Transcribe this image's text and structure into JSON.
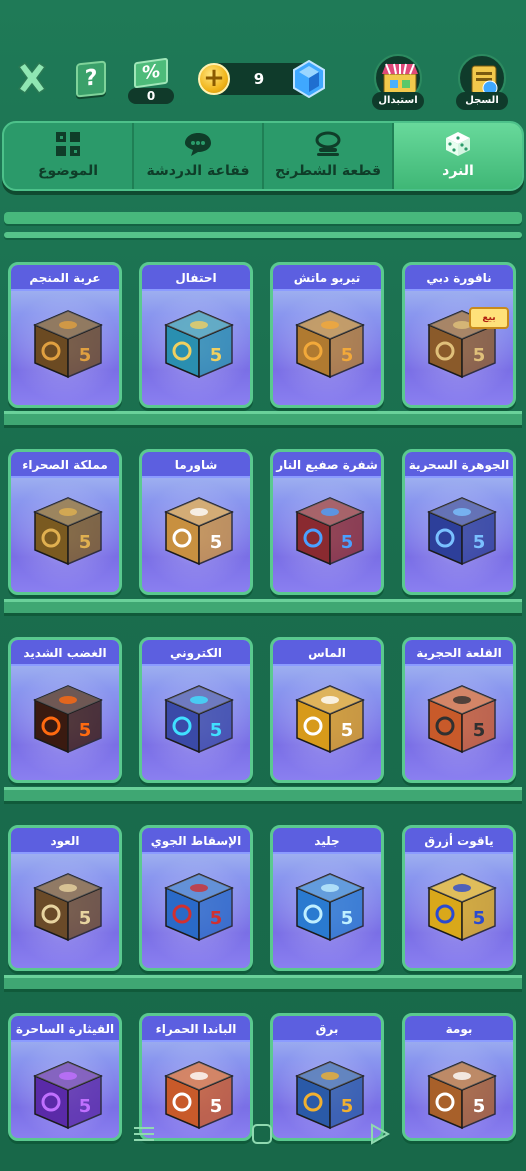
{
  "topbar": {
    "discount_count": "0",
    "gems_count": "9",
    "shop_label": "استبدال",
    "record_label": "السجل",
    "help_symbol": "?",
    "discount_symbol": "%"
  },
  "tabs": [
    {
      "label": "النرد",
      "icon": "dice-icon",
      "active": true
    },
    {
      "label": "قطعة الشطرنج",
      "icon": "chess-piece-icon",
      "active": false
    },
    {
      "label": "فقاعة الدردشة",
      "icon": "chat-bubble-icon",
      "active": false
    },
    {
      "label": "الموضوع",
      "icon": "theme-grid-icon",
      "active": false
    }
  ],
  "items": [
    {
      "label": "نافورة دبي",
      "color": "#8a5a2a",
      "accent": "#e0c07a",
      "tag": "بيع"
    },
    {
      "label": "تيربو ماتش",
      "color": "#b07a30",
      "accent": "#f2a93a"
    },
    {
      "label": "احتفال",
      "color": "#2a8fb0",
      "accent": "#f0d060"
    },
    {
      "label": "عربة المنجم",
      "color": "#6b4a22",
      "accent": "#e0a040"
    },
    {
      "label": "الجوهرة السحرية",
      "color": "#2d3f9a",
      "accent": "#7ac0ff"
    },
    {
      "label": "شفرة صفيع النار",
      "color": "#8a2a30",
      "accent": "#4aa0ff"
    },
    {
      "label": "شاورما",
      "color": "#c89040",
      "accent": "#ffffff"
    },
    {
      "label": "مملكة الصحراء",
      "color": "#7a5a20",
      "accent": "#e0b050"
    },
    {
      "label": "القلعة الحجرية",
      "color": "#c85a2a",
      "accent": "#303030"
    },
    {
      "label": "الماس",
      "color": "#d79a1a",
      "accent": "#ffffff"
    },
    {
      "label": "الكتروني",
      "color": "#3a4aa8",
      "accent": "#40e0ff"
    },
    {
      "label": "الغضب الشديد",
      "color": "#3a1a10",
      "accent": "#ff6a10"
    },
    {
      "label": "ياقوت أزرق",
      "color": "#d9a81a",
      "accent": "#2a4ad0"
    },
    {
      "label": "جليد",
      "color": "#2a7ad0",
      "accent": "#bfefff"
    },
    {
      "label": "الإسقاط الجوي",
      "color": "#2a6ac8",
      "accent": "#d03030"
    },
    {
      "label": "العود",
      "color": "#6a4a28",
      "accent": "#e8d4a0"
    },
    {
      "label": "بومة",
      "color": "#a8602a",
      "accent": "#ffffff"
    },
    {
      "label": "برق",
      "color": "#2a5aa8",
      "accent": "#f0b030"
    },
    {
      "label": "الباندا الحمراء",
      "color": "#c85a2a",
      "accent": "#ffffff"
    },
    {
      "label": "القيثارة الساحرة",
      "color": "#5a2aa8",
      "accent": "#c070ff"
    }
  ]
}
